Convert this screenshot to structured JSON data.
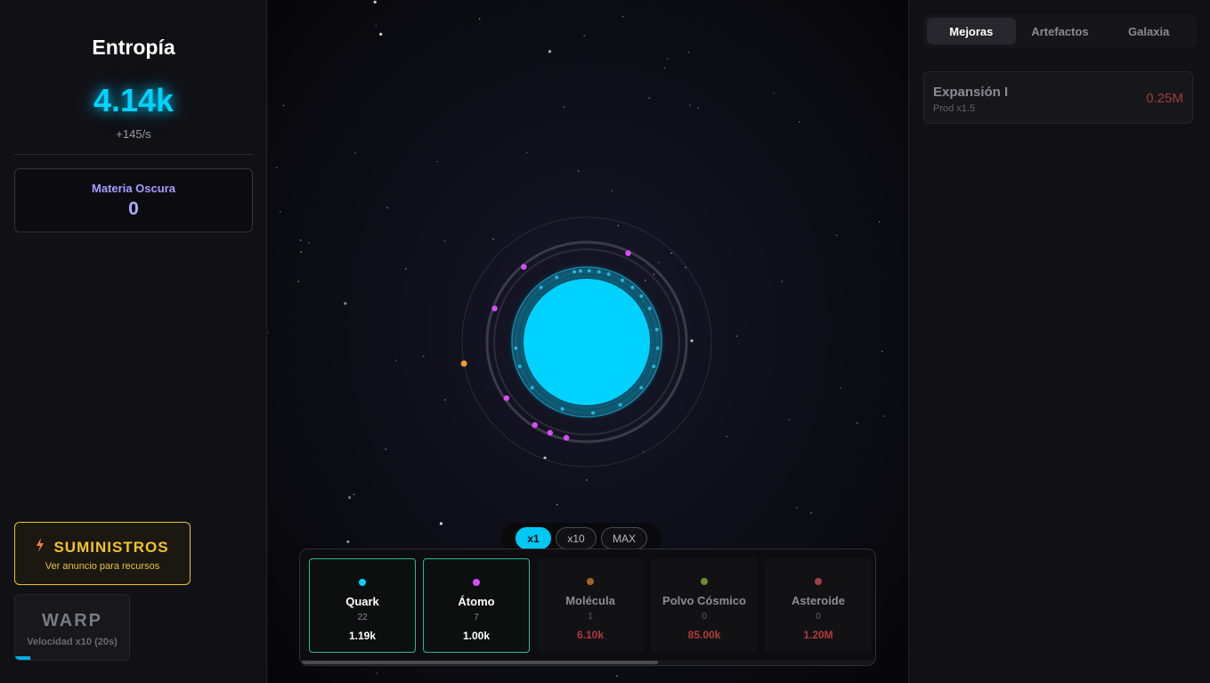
{
  "left_panel": {
    "resource_title": "Entropía",
    "resource_value": "4.14k",
    "resource_rate": "+145/s",
    "dark_matter_label": "Materia Oscura",
    "dark_matter_value": "0",
    "supplies": {
      "icon": "lightning-bolt-icon",
      "title": "SUMINISTROS",
      "subtitle": "Ver anuncio para recursos",
      "accent_color": "#f3c22c"
    },
    "warp": {
      "title": "WARP",
      "subtitle": "Velocidad x10 (20s)",
      "charge_fraction": 0.13
    }
  },
  "multiplier": {
    "options": [
      "x1",
      "x10",
      "MAX"
    ],
    "selected": "x1"
  },
  "generators": [
    {
      "name": "Quark",
      "count": "22",
      "cost": "1.19k",
      "color": "#00d2ff",
      "affordable": true
    },
    {
      "name": "Átomo",
      "count": "7",
      "cost": "1.00k",
      "color": "#d94dff",
      "affordable": true
    },
    {
      "name": "Molécula",
      "count": "1",
      "cost": "6.10k",
      "color": "#a0651f",
      "affordable": false
    },
    {
      "name": "Polvo Cósmico",
      "count": "0",
      "cost": "85.00k",
      "color": "#6f8c2a",
      "affordable": false
    },
    {
      "name": "Asteroide",
      "count": "0",
      "cost": "1.20M",
      "color": "#a04040",
      "affordable": false
    }
  ],
  "right_panel": {
    "tabs": [
      "Mejoras",
      "Artefactos",
      "Galaxia"
    ],
    "active_tab": "Mejoras",
    "upgrades": [
      {
        "name": "Expansión I",
        "description": "Prod x1.5",
        "cost": "0.25M"
      }
    ]
  },
  "colors": {
    "primary_accent": "#00d2ff",
    "affordable_border": "#2fb890",
    "unaffordable_cost": "#b23b3b"
  }
}
